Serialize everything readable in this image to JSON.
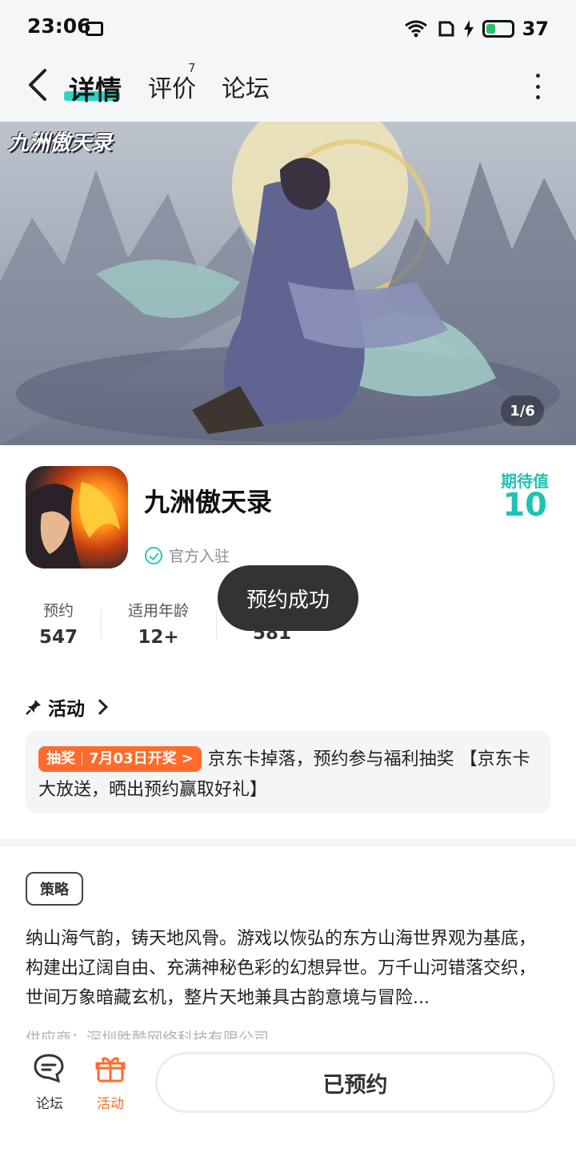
{
  "status_bar": {
    "time": "23:06",
    "battery": "37",
    "battery_level_percent": 37
  },
  "nav": {
    "tabs": [
      {
        "label": "详情",
        "active": true
      },
      {
        "label": "评价",
        "badge": "7"
      },
      {
        "label": "论坛"
      }
    ]
  },
  "banner": {
    "logo_text": "九洲傲天录",
    "pager": "1/6"
  },
  "app": {
    "name": "九洲傲天录",
    "verified_label": "官方入驻",
    "expect_label": "期待值",
    "expect_value": "10"
  },
  "stats": [
    {
      "label": "预约",
      "value": "547"
    },
    {
      "label": "适用年龄",
      "value": "12+"
    },
    {
      "label": "",
      "value": "581"
    }
  ],
  "toast": "预约成功",
  "activity": {
    "title": "活动",
    "tag_left": "抽奖",
    "tag_right": "7月03日开奖",
    "text": "京东卡掉落，预约参与福利抽奖 【京东卡大放送，晒出预约赢取好礼】"
  },
  "strategy": {
    "chip": "策略",
    "description": "纳山海气韵，铸天地风骨。游戏以恢弘的东方山海世界观为基底，构建出辽阔自由、充满神秘色彩的幻想异世。万千山河错落交织，世间万象暗藏玄机，整片天地兼具古韵意境与冒险...",
    "supplier": "供应商：深圳胜酷网络科技有限公司"
  },
  "bottom": {
    "forum_label": "论坛",
    "events_label": "活动",
    "reserved_label": "已预约"
  },
  "colors": {
    "accent": "#2bd4c4",
    "orange": "#ff6b2c",
    "toast_bg": "#333333"
  }
}
